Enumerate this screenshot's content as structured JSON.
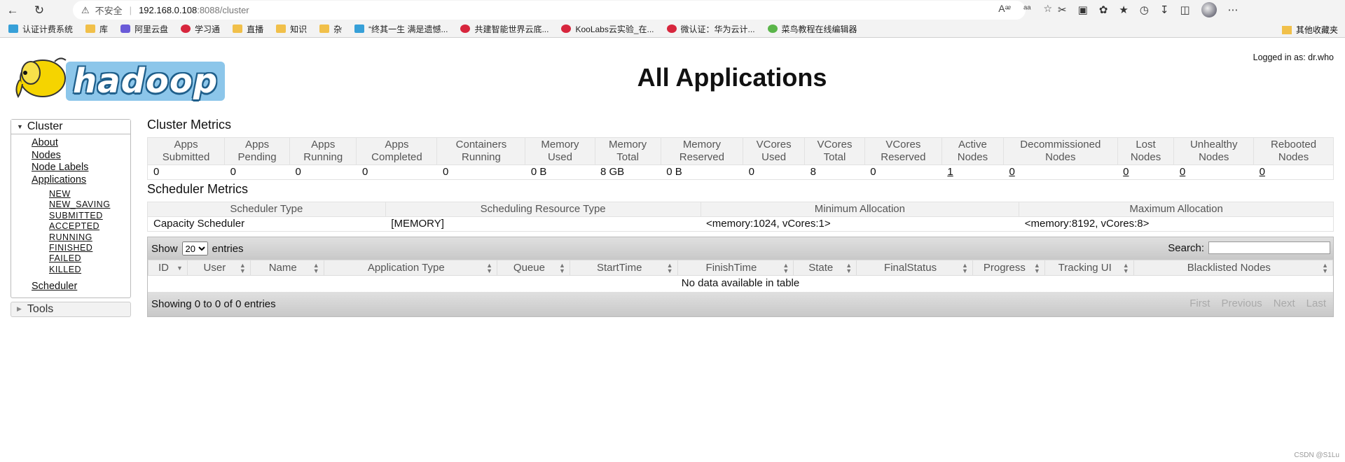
{
  "browser": {
    "security_label": "不安全",
    "url_host": "192.168.0.108",
    "url_path": ":8088/cluster",
    "bookmarks": [
      {
        "label": "认证计费系统",
        "icon": "globe-icon"
      },
      {
        "label": "库",
        "icon": "folder-icon"
      },
      {
        "label": "阿里云盘",
        "icon": "cloud-drive-icon"
      },
      {
        "label": "学习通",
        "icon": "study-icon"
      },
      {
        "label": "直播",
        "icon": "folder-icon"
      },
      {
        "label": "知识",
        "icon": "folder-icon"
      },
      {
        "label": "杂",
        "icon": "folder-icon"
      },
      {
        "label": "“终其一生 满是遗憾...",
        "icon": "bilibili-icon"
      },
      {
        "label": "共建智能世界云底...",
        "icon": "huawei-icon"
      },
      {
        "label": "KooLabs云实验_在...",
        "icon": "huawei-icon"
      },
      {
        "label": "微认证：华为云计...",
        "icon": "huawei-icon"
      },
      {
        "label": "菜鸟教程在线编辑器",
        "icon": "runoob-icon"
      }
    ],
    "other_bookmarks": "其他收藏夹"
  },
  "header": {
    "logo_text": "hadoop",
    "title": "All Applications",
    "logged_in": "Logged in as: dr.who"
  },
  "sidebar": {
    "cluster_label": "Cluster",
    "links": [
      "About",
      "Nodes",
      "Node Labels",
      "Applications"
    ],
    "app_states": [
      "NEW",
      "NEW_SAVING",
      "SUBMITTED",
      "ACCEPTED",
      "RUNNING",
      "FINISHED",
      "FAILED",
      "KILLED"
    ],
    "scheduler": "Scheduler",
    "tools_label": "Tools"
  },
  "cluster_metrics": {
    "title": "Cluster Metrics",
    "headers": [
      [
        "Apps",
        "Submitted"
      ],
      [
        "Apps",
        "Pending"
      ],
      [
        "Apps",
        "Running"
      ],
      [
        "Apps",
        "Completed"
      ],
      [
        "Containers",
        "Running"
      ],
      [
        "Memory",
        "Used"
      ],
      [
        "Memory",
        "Total"
      ],
      [
        "Memory",
        "Reserved"
      ],
      [
        "VCores",
        "Used"
      ],
      [
        "VCores",
        "Total"
      ],
      [
        "VCores",
        "Reserved"
      ],
      [
        "Active",
        "Nodes"
      ],
      [
        "Decommissioned",
        "Nodes"
      ],
      [
        "Lost",
        "Nodes"
      ],
      [
        "Unhealthy",
        "Nodes"
      ],
      [
        "Rebooted",
        "Nodes"
      ]
    ],
    "values": [
      "0",
      "0",
      "0",
      "0",
      "0",
      "0 B",
      "8 GB",
      "0 B",
      "0",
      "8",
      "0",
      "1",
      "0",
      "0",
      "0",
      "0"
    ]
  },
  "scheduler_metrics": {
    "title": "Scheduler Metrics",
    "headers": [
      "Scheduler Type",
      "Scheduling Resource Type",
      "Minimum Allocation",
      "Maximum Allocation"
    ],
    "values": [
      "Capacity Scheduler",
      "[MEMORY]",
      "<memory:1024, vCores:1>",
      "<memory:8192, vCores:8>"
    ]
  },
  "apps_table": {
    "show_label": "Show",
    "page_size": "20",
    "entries_label": "entries",
    "search_label": "Search:",
    "columns": [
      "ID",
      "User",
      "Name",
      "Application Type",
      "Queue",
      "StartTime",
      "FinishTime",
      "State",
      "FinalStatus",
      "Progress",
      "Tracking UI",
      "Blacklisted Nodes"
    ],
    "empty_message": "No data available in table",
    "info": "Showing 0 to 0 of 0 entries",
    "pager": [
      "First",
      "Previous",
      "Next",
      "Last"
    ]
  },
  "watermark": "CSDN @S1Lu"
}
